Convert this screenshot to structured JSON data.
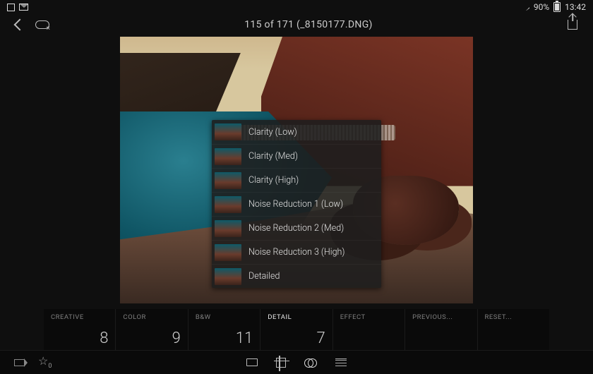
{
  "status": {
    "battery": "90%",
    "time": "13:42"
  },
  "header": {
    "title": "115 of 171 (_8150177.DNG)"
  },
  "preset_menu": [
    "Clarity (Low)",
    "Clarity (Med)",
    "Clarity (High)",
    "Noise Reduction 1 (Low)",
    "Noise Reduction 2 (Med)",
    "Noise Reduction 3 (High)",
    "Detailed"
  ],
  "tabs": [
    {
      "label": "CREATIVE",
      "value": "8"
    },
    {
      "label": "COLOR",
      "value": "9"
    },
    {
      "label": "B&W",
      "value": "11"
    },
    {
      "label": "DETAIL",
      "value": "7"
    },
    {
      "label": "EFFECT",
      "value": ""
    },
    {
      "label": "PREVIOUS...",
      "value": ""
    },
    {
      "label": "RESET...",
      "value": ""
    }
  ],
  "active_tab_index": 3
}
